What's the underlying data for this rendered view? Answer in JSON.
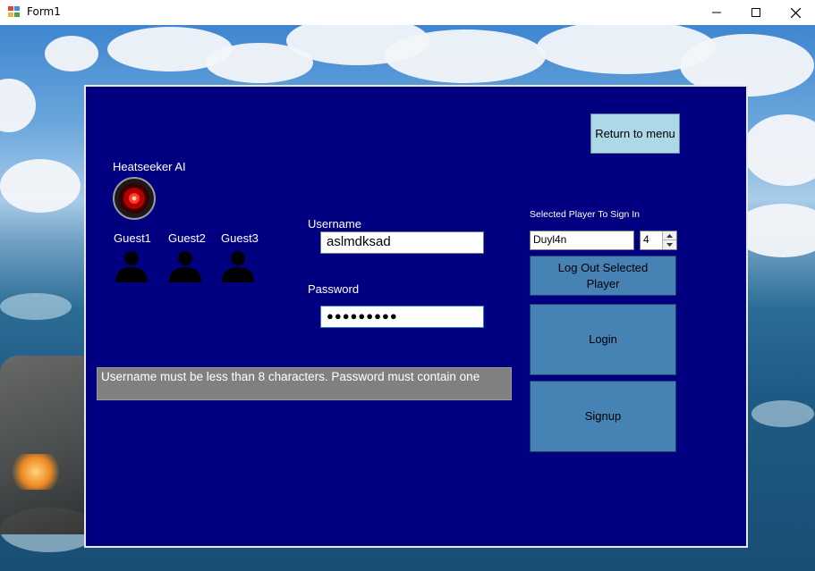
{
  "window": {
    "title": "Form1",
    "controls": {
      "minimize_icon": "minimize-icon",
      "maximize_icon": "maximize-icon",
      "close_icon": "close-icon"
    }
  },
  "panel": {
    "return_button": "Return to menu",
    "ai": {
      "label": "Heatseeker AI",
      "icon": "hal-eye-icon"
    },
    "guests": [
      {
        "label": "Guest1",
        "icon": "person-icon"
      },
      {
        "label": "Guest2",
        "icon": "person-icon"
      },
      {
        "label": "Guest3",
        "icon": "person-icon"
      }
    ],
    "login_form": {
      "username_label": "Username",
      "username_value": "aslmdksad",
      "password_label": "Password",
      "password_value": "●●●●●●●●●"
    },
    "error_message": "Username must be less than 8 characters. Password must contain one",
    "player_select": {
      "label": "Selected Player To Sign In",
      "player_name": "Duyl4n",
      "player_number": "4"
    },
    "buttons": {
      "logout": "Log Out Selected Player",
      "login": "Login",
      "signup": "Signup"
    }
  },
  "colors": {
    "panel_bg": "#000080",
    "button_bg": "#4682b4",
    "return_button_bg": "#add8e6",
    "error_bg": "#808080"
  }
}
